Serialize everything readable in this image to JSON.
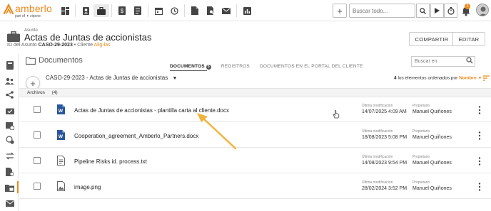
{
  "app": {
    "logo_text": "amberlo",
    "logo_sub": "part of ✦ zipone"
  },
  "topbar": {
    "nav_icons": [
      "dashboard-icon",
      "contacts-icon",
      "matters-icon",
      "billing-icon",
      "reports-icon",
      "calendar-icon",
      "time-icon",
      "documents-icon",
      "document-search-icon",
      "mail-icon",
      "analytics-icon"
    ],
    "search_placeholder": "Buscar todo...",
    "notification_count": "2"
  },
  "header": {
    "section_label": "Asunto",
    "title": "Actas de Juntas de accionistas",
    "id_label": "ID del Asunto",
    "id_value": "CASO-29-2023",
    "separator": "•",
    "client_label": "Cliente",
    "client_value": "Alig-las",
    "share_label": "COMPARTIR",
    "edit_label": "EDITAR"
  },
  "documents": {
    "heading": "Documentos",
    "search_placeholder": "Buscar en",
    "tabs": [
      {
        "label": "DOCUMENTOS",
        "badge": "5",
        "active": true
      },
      {
        "label": "REGISTROS"
      },
      {
        "label": "DOCUMENTOS EN EL PORTAL DEL CLIENTE"
      }
    ],
    "breadcrumb": "CASO-29-2023 - Actas de Juntas de accionistas",
    "count": "4",
    "sort_text": "los elementos ordenados por",
    "sort_field": "Nombre",
    "files_label": "Archivos",
    "files_count": "(4)",
    "modified_label": "Última modificación",
    "owner_label": "Propietario",
    "rows": [
      {
        "name": "Actas de Juntas de accionistas - plantilla carta al cliente.docx",
        "type": "word",
        "modified": "14/07/2025 4:09 AM",
        "owner": "Manuel Quiñones"
      },
      {
        "name": "Cooperation_agreement_Amberlo_Partners.docx",
        "type": "word",
        "modified": "18/08/2023 5:08 PM",
        "owner": "Manuel Quiñones"
      },
      {
        "name": "Pipeline Risks id. process.txt",
        "type": "text",
        "modified": "14/08/2023 9:54 PM",
        "owner": "Manuel Quiñones"
      },
      {
        "name": "image.png",
        "type": "image",
        "modified": "28/02/2024 3:52 PM",
        "owner": "Manuel Quiñones"
      }
    ]
  },
  "colors": {
    "accent": "#f08a1c",
    "annotation_arrow": "#f2b33d",
    "word_blue": "#2b579a"
  }
}
